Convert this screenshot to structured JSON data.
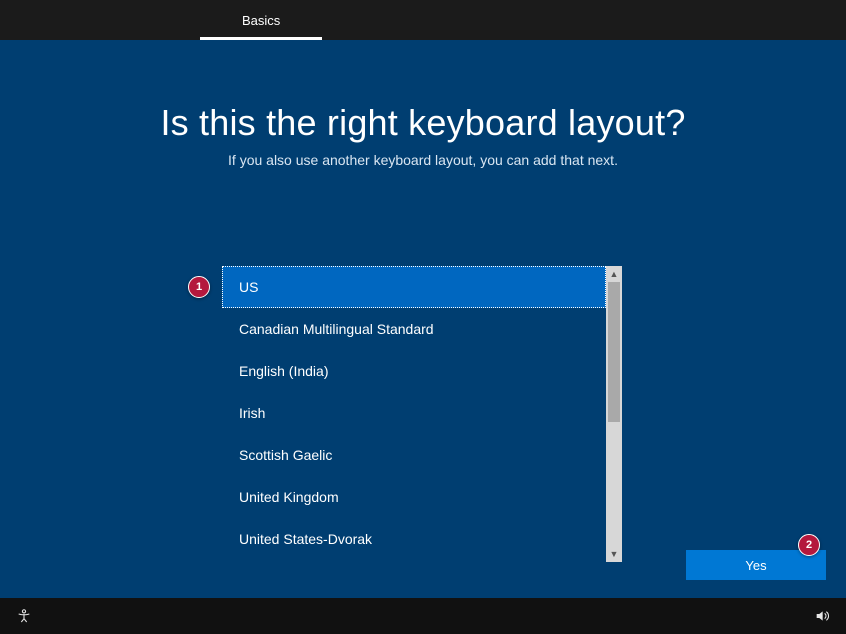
{
  "tabs": {
    "basics": "Basics"
  },
  "heading": "Is this the right keyboard layout?",
  "subheading": "If you also use another keyboard layout, you can add that next.",
  "layouts": [
    "US",
    "Canadian Multilingual Standard",
    "English (India)",
    "Irish",
    "Scottish Gaelic",
    "United Kingdom",
    "United States-Dvorak"
  ],
  "selected_index": 0,
  "buttons": {
    "yes": "Yes"
  },
  "callouts": {
    "one": "1",
    "two": "2"
  }
}
